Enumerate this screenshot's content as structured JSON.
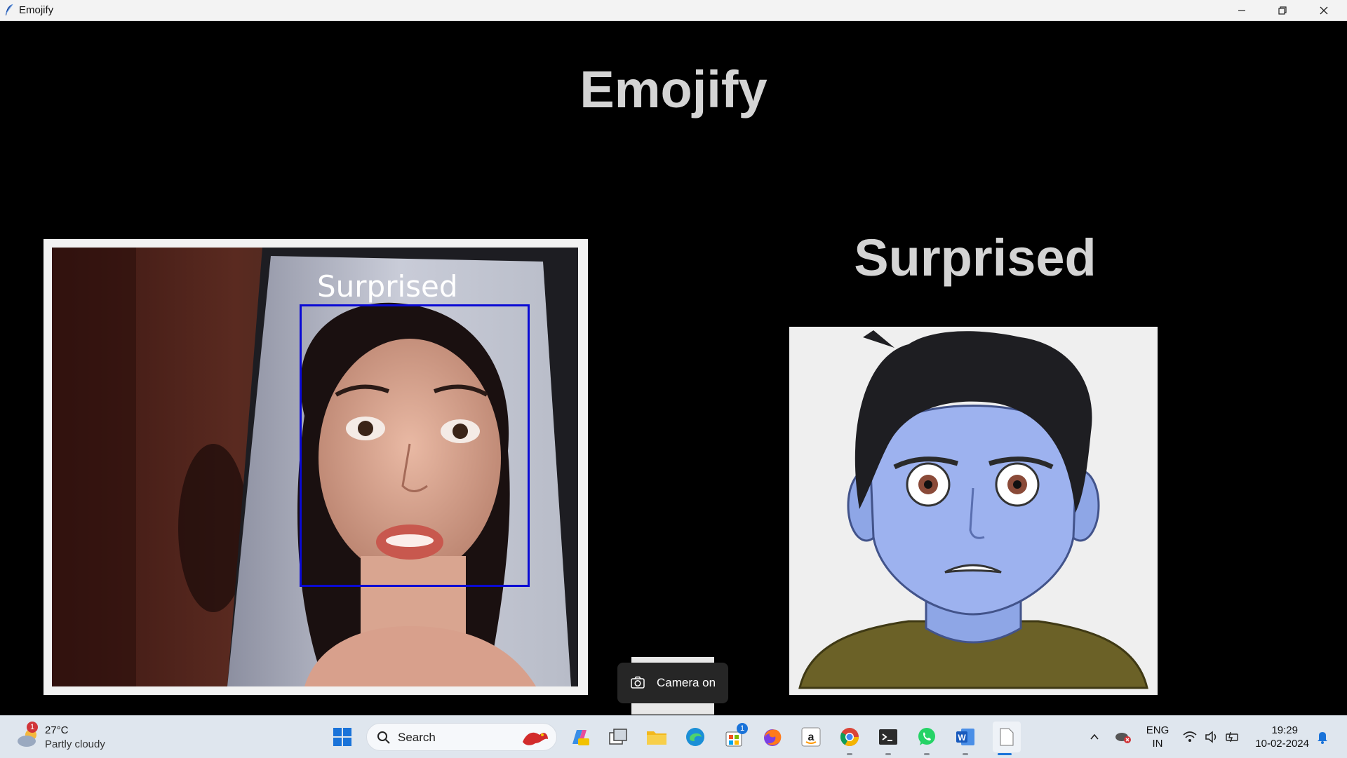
{
  "window": {
    "title": "Emojify"
  },
  "app": {
    "title": "Emojify",
    "emotion_label": "Surprised",
    "face_label": "Surprised"
  },
  "toast": {
    "text": "Camera on"
  },
  "taskbar": {
    "weather": {
      "temp": "27°C",
      "condition": "Partly cloudy",
      "badge": "1"
    },
    "search_label": "Search",
    "store_badge": "1",
    "lang_top": "ENG",
    "lang_bottom": "IN",
    "time": "19:29",
    "date": "10-02-2024"
  },
  "colors": {
    "face_box": "#0a0ad4",
    "title_text": "#d4d4d4",
    "background": "#000000"
  }
}
